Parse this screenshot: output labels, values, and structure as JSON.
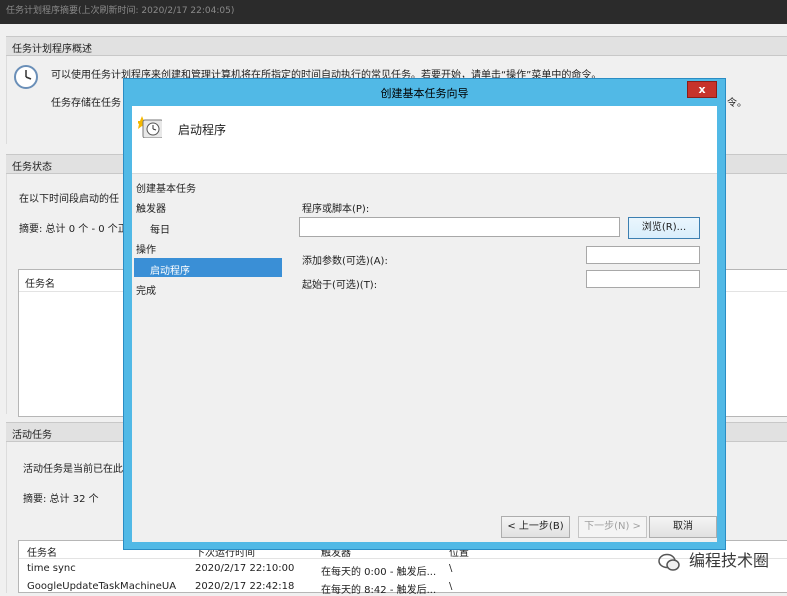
{
  "background": {
    "titlebar": "任务计划程序摘要(上次刷新时间: 2020/2/17 22:04:05)",
    "overview": {
      "header": "任务计划程序概述",
      "line1": "可以使用任务计划程序来创建和管理计算机将在所指定的时间自动执行的常见任务。若要开始，请单击“操作”菜单中的命令。",
      "line2_start": "任务存储在任务",
      "line2_end": "令。"
    },
    "status": {
      "header": "任务状态",
      "line1": "在以下时间段启动的任",
      "summary": "摘要: 总计 0 个 - 0 个正",
      "list_header": "任务名"
    },
    "active": {
      "header": "活动任务",
      "line1": "活动任务是当前已在此",
      "summary": "摘要: 总计 32 个",
      "columns": [
        "任务名",
        "下次运行时间",
        "触发器",
        "位置"
      ],
      "rows": [
        [
          "time sync",
          "2020/2/17 22:10:00",
          "在每天的 0:00 - 触发后...",
          "\\"
        ],
        [
          "GoogleUpdateTaskMachineUA",
          "2020/2/17 22:42:18",
          "在每天的 8:42 - 触发后...",
          "\\"
        ]
      ]
    }
  },
  "dialog": {
    "title": "创建基本任务向导",
    "close_label": "x",
    "banner_title": "启动程序",
    "nav": {
      "create": "创建基本任务",
      "trigger": "触发器",
      "daily": "每日",
      "action": "操作",
      "start_program": "启动程序",
      "finish": "完成"
    },
    "form": {
      "program_label": "程序或脚本(P):",
      "program_value": "",
      "browse_label": "浏览(R)...",
      "args_label": "添加参数(可选)(A):",
      "args_value": "",
      "start_in_label": "起始于(可选)(T):",
      "start_in_value": ""
    },
    "buttons": {
      "back": "< 上一步(B)",
      "next": "下一步(N) >",
      "cancel": "取消"
    }
  },
  "watermark": "编程技术圈",
  "colors": {
    "dialog_frame": "#51b9e6",
    "close_button": "#c7332b",
    "nav_selected": "#3a8fd6"
  }
}
